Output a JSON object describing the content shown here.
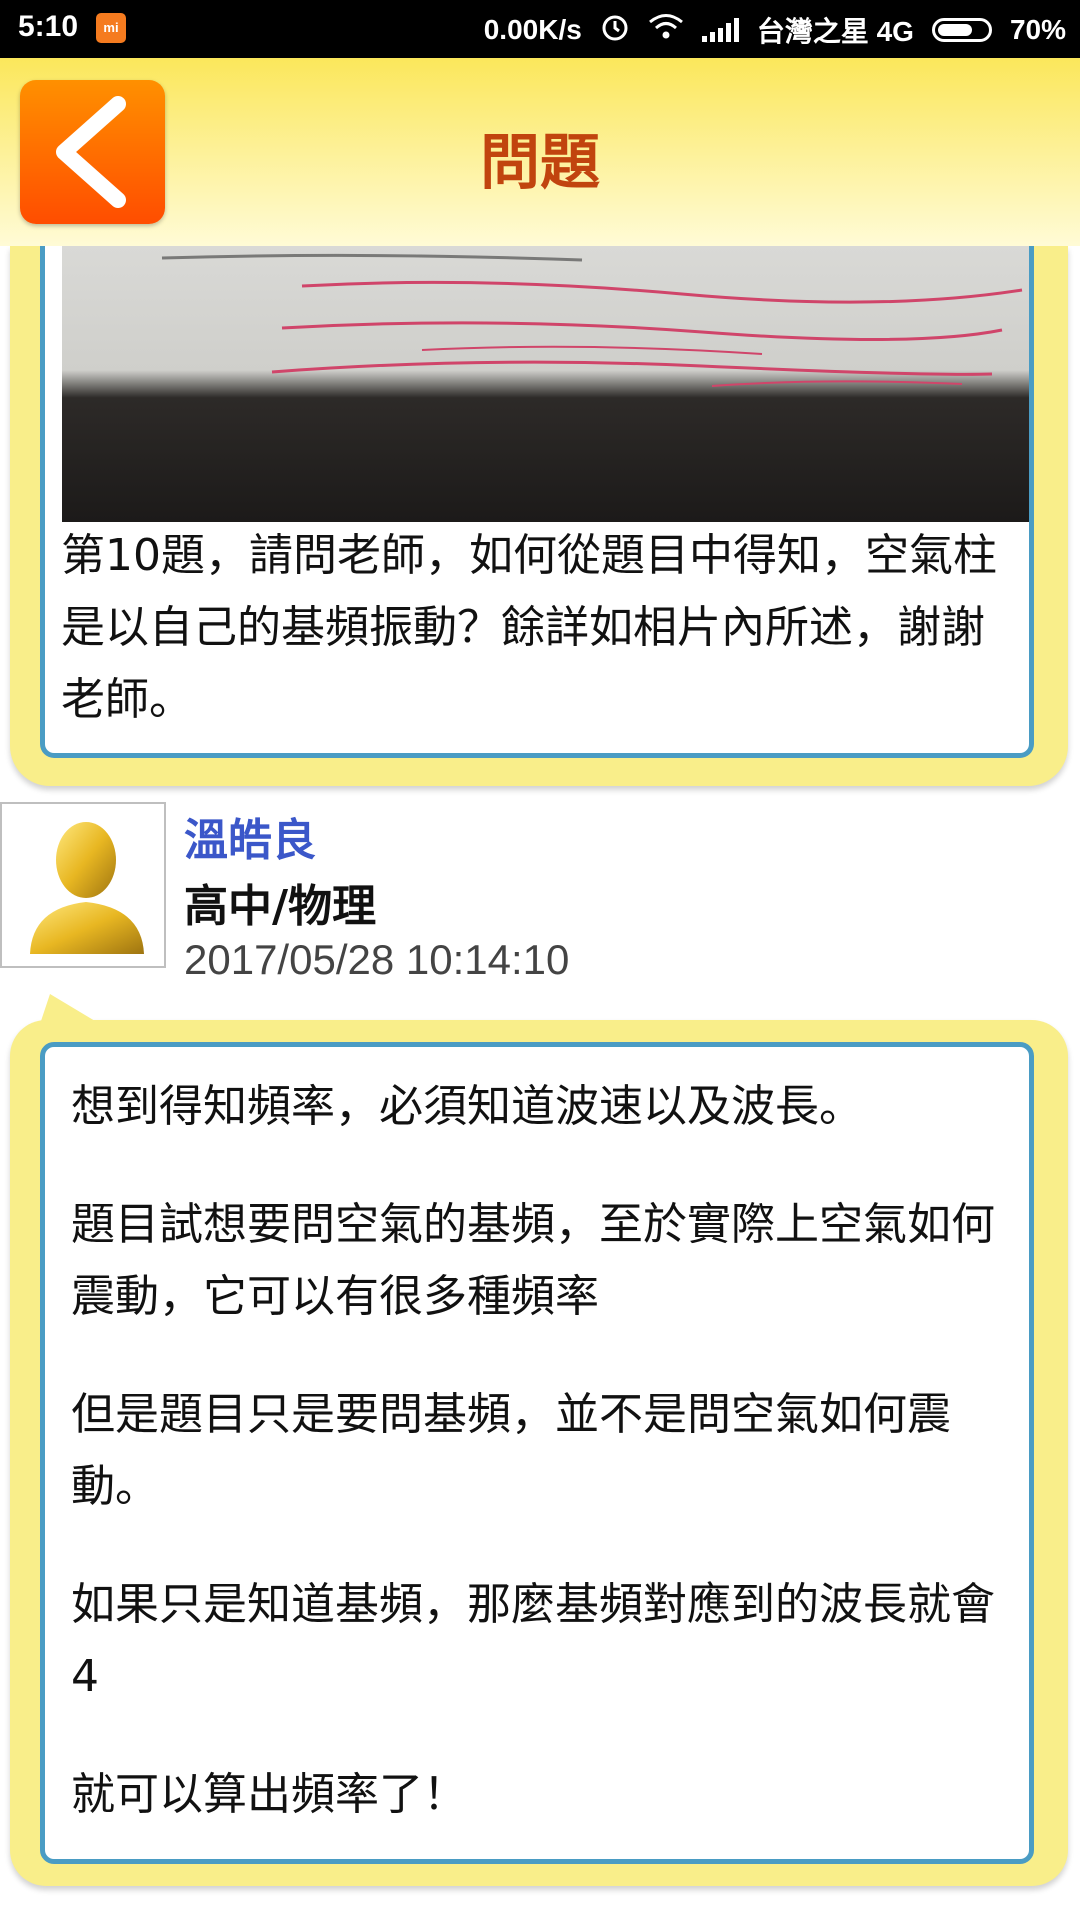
{
  "status_bar": {
    "time": "5:10",
    "mi_icon": "mi",
    "net_speed": "0.00K/s",
    "carrier": "台灣之星 4G",
    "battery": "70%",
    "battery_level": 0.7
  },
  "header": {
    "title": "問題",
    "back_icon": "chevron-left-icon"
  },
  "question": {
    "text": "第10題，請問老師，如何從題目中得知，空氣柱是以自己的基頻振動？餘詳如相片內所述，謝謝老師。"
  },
  "reply": {
    "author": "溫皓良",
    "subject": "高中/物理",
    "timestamp": "2017/05/28 10:14:10",
    "avatar_icon": "user-avatar-icon",
    "paragraphs": [
      "想到得知頻率，必須知道波速以及波長。",
      "題目試想要問空氣的基頻，至於實際上空氣如何震動，它可以有很多種頻率",
      "但是題目只是要問基頻，並不是問空氣如何震動。",
      "如果只是知道基頻，那麼基頻對應到的波長就會4",
      "就可以算出頻率了！"
    ]
  },
  "colors": {
    "header_top": "#fbe75b",
    "title": "#c1440e",
    "back_button": "#ff6a00",
    "card_bg": "#f9ee8a",
    "card_border": "#4a9cc4",
    "author": "#3b57c9"
  }
}
